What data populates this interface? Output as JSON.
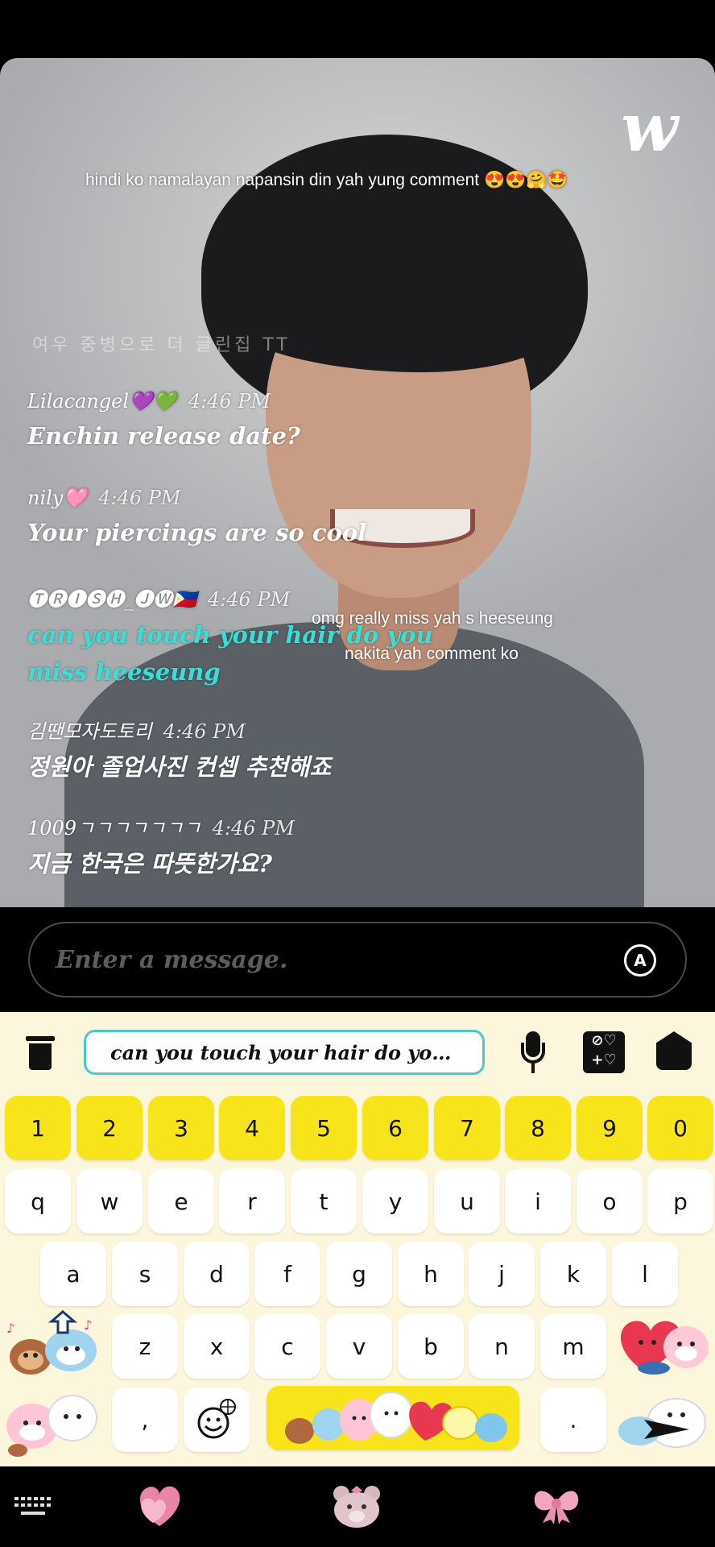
{
  "overlay_comments": {
    "top": "hindi ko namalayan napansin din yah yung comment 😍😍🤗🤩",
    "mid1": "omg really miss yah s heeseung",
    "mid2": "nakita yah comment ko"
  },
  "faded_line": "여우 중병으로 더 글린집 TT",
  "chat": [
    {
      "user": "Lilacangel💜💚",
      "time": "4:46 PM",
      "text": "Enchin release date?"
    },
    {
      "user": "nily🩷",
      "time": "4:46 PM",
      "text": "Your piercings are so cool"
    },
    {
      "user": "🅣🅡🅘🅢🅗_🅙🅦🇵🇭",
      "time": "4:46 PM",
      "text": "can you touch your hair do you",
      "text2": "miss heeseung"
    },
    {
      "user": "김땐모자도토리",
      "time": "4:46 PM",
      "text": "정원아 졸업사진 컨셉 추천해죠"
    },
    {
      "user": "1009ㄱㄱㄱㄱㄱㄱㄱ",
      "time": "4:46 PM",
      "text": "지금 한국은 따뜻한가요?"
    }
  ],
  "input": {
    "placeholder": "Enter a message."
  },
  "keyboard": {
    "clipboard": "can you touch your hair do you m...",
    "calc_top": "⊘♡",
    "calc_bottom": "+♡",
    "numbers": [
      "1",
      "2",
      "3",
      "4",
      "5",
      "6",
      "7",
      "8",
      "9",
      "0"
    ],
    "row1": [
      "q",
      "w",
      "e",
      "r",
      "t",
      "y",
      "u",
      "i",
      "o",
      "p"
    ],
    "row2": [
      "a",
      "s",
      "d",
      "f",
      "g",
      "h",
      "j",
      "k",
      "l"
    ],
    "row3": [
      "z",
      "x",
      "c",
      "v",
      "b",
      "n",
      "m"
    ],
    "comma": ",",
    "period": "."
  },
  "colors": {
    "accent_cyan": "#37e0d6",
    "key_yellow": "#f7e41a",
    "kb_bg": "#fbf6dc"
  }
}
